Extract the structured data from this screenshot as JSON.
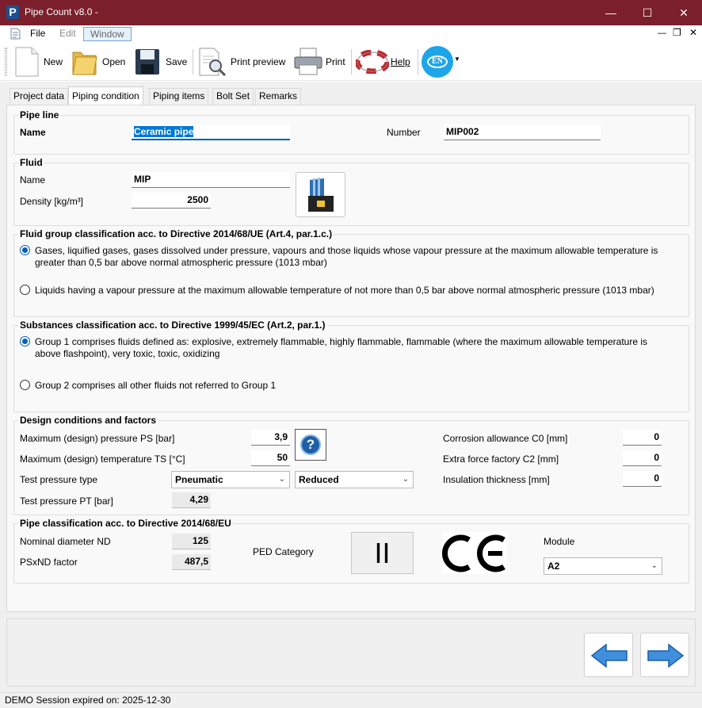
{
  "window": {
    "title": "Pipe Count v8.0 -"
  },
  "menu": {
    "file": "File",
    "edit": "Edit",
    "window": "Window"
  },
  "toolbar": {
    "new": "New",
    "open": "Open",
    "save": "Save",
    "print_preview": "Print preview",
    "print": "Print",
    "help": "Help",
    "language": "EN"
  },
  "tabs": [
    "Project data",
    "Piping condition",
    "Piping items",
    "Bolt Set",
    "Remarks"
  ],
  "pipeline": {
    "title": "Pipe line",
    "name_label": "Name",
    "name_value": "Ceramic pipe",
    "number_label": "Number",
    "number_value": "MIP002"
  },
  "fluid": {
    "title": "Fluid",
    "name_label": "Name",
    "name_value": "MIP",
    "density_label": "Density [kg/m³]",
    "density_value": "2500"
  },
  "fluid_group": {
    "title": "Fluid group classification acc. to Directive 2014/68/UE (Art.4, par.1.c.)",
    "option1_line1": "Gases, liquified gases, gases dissolved under pressure, vapours and those liquids whose vapour pressure at the maximum allowable temperature is",
    "option1_line2": "greater than 0,5 bar above normal atmospheric pressure (1013 mbar)",
    "option2": "Liquids having a vapour pressure at the maximum allowable temperature of not more than 0,5 bar above normal atmospheric pressure (1013 mbar)",
    "selected": 1
  },
  "substances": {
    "title": "Substances classification acc. to Directive 1999/45/EC (Art.2, par.1.)",
    "option1_line1": "Group 1 comprises fluids defined as: explosive, extremely flammable, highly flammable,  flammable (where the maximum allowable temperature is",
    "option1_line2": "above flashpoint), very toxic, toxic, oxidizing",
    "option2": "Group 2 comprises all other fluids not referred to Group 1",
    "selected": 1
  },
  "design": {
    "title": "Design conditions and factors",
    "pressure_label": "Maximum (design) pressure PS [bar]",
    "pressure_value": "3,9",
    "temperature_label": "Maximum (design) temperature TS [°C]",
    "temperature_value": "50",
    "test_type_label": "Test pressure type",
    "test_type_value": "Pneumatic",
    "test_mode_value": "Reduced",
    "test_pressure_label": "Test pressure PT [bar]",
    "test_pressure_value": "4,29",
    "corrosion_label": "Corrosion allowance C0 [mm]",
    "corrosion_value": "0",
    "extra_force_label": "Extra force factory C2 [mm]",
    "extra_force_value": "0",
    "insulation_label": "Insulation thickness [mm]",
    "insulation_value": "0",
    "help_icon": "question-icon"
  },
  "classification": {
    "title": "Pipe classification acc. to Directive 2014/68/EU",
    "nd_label": "Nominal diameter ND",
    "nd_value": "125",
    "psxnd_label": "PSxND factor",
    "psxnd_value": "487,5",
    "category_label": "PED Category",
    "category_value": "II",
    "ce_mark": "CE",
    "module_label": "Module",
    "module_value": "A2"
  },
  "status": {
    "text": "DEMO Session expired on: 2025-12-30"
  },
  "colors": {
    "titlebar": "#7a1f2b",
    "accent": "#005fb8",
    "language_badge": "#1ea5e9"
  }
}
